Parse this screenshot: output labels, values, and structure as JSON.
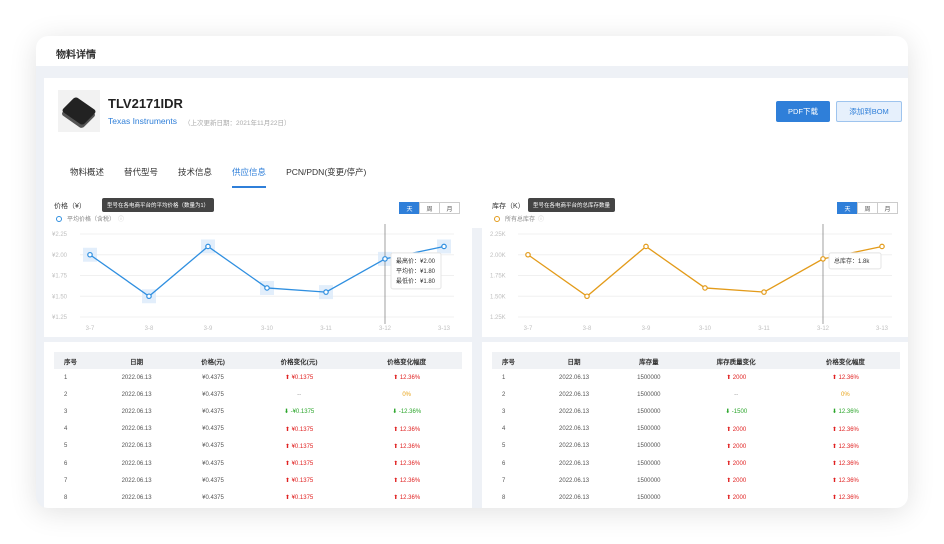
{
  "header": {
    "title": "物料详情"
  },
  "product": {
    "part_number": "TLV2171IDR",
    "manufacturer": "Texas Instruments",
    "update_date": "（上次更新日期：2021年11月22日）",
    "icon": "chip-icon"
  },
  "actions": {
    "pdf_label": "PDF下载",
    "bom_label": "添加到BOM"
  },
  "tabs": [
    "物料概述",
    "替代型号",
    "技术信息",
    "供应信息",
    "PCN/PDN(变更/停产)"
  ],
  "active_tab": "供应信息",
  "period_options": [
    "天",
    "周",
    "月"
  ],
  "colors": {
    "accent": "#2f7fd9",
    "price_line": "#2f8fe0",
    "stock_line": "#e39b1a",
    "up": "#e02020",
    "down": "#2aa52a"
  },
  "price_chart": {
    "title": "价格（¥）",
    "tooltip": "型号在各电商平台的平均价格（数量为1）",
    "legend": "平均价格（含税）",
    "hover": {
      "max_label": "最高价：¥2.00",
      "avg_label": "平均价：¥1.80",
      "min_label": "最低价：¥1.80"
    }
  },
  "stock_chart": {
    "title": "库存（K）",
    "tooltip": "型号在各电商平台的总库存数量",
    "legend": "所有总库存",
    "hover": {
      "total_label": "总库存：1.8k"
    }
  },
  "chart_data": [
    {
      "type": "line",
      "title": "价格（¥）",
      "categories": [
        "3-7",
        "3-8",
        "3-9",
        "3-10",
        "3-11",
        "3-12",
        "3-13"
      ],
      "y_ticks": [
        "¥2.25",
        "¥2.00",
        "¥1.75",
        "¥1.50",
        "¥1.25"
      ],
      "ylim": [
        1.25,
        2.25
      ],
      "series": [
        {
          "name": "平均价格（含税）",
          "values": [
            2.0,
            1.5,
            2.1,
            1.6,
            1.55,
            1.95,
            2.1
          ]
        }
      ],
      "grid": true,
      "legend_position": "top-left"
    },
    {
      "type": "line",
      "title": "库存（K）",
      "categories": [
        "3-7",
        "3-8",
        "3-9",
        "3-10",
        "3-11",
        "3-12",
        "3-13"
      ],
      "y_ticks": [
        "2.25K",
        "2.00K",
        "1.75K",
        "1.50K",
        "1.25K"
      ],
      "ylim": [
        1.25,
        2.25
      ],
      "series": [
        {
          "name": "所有总库存",
          "values": [
            2.0,
            1.5,
            2.1,
            1.6,
            1.55,
            1.95,
            2.1
          ]
        }
      ],
      "grid": true,
      "legend_position": "top-left"
    }
  ],
  "price_table": {
    "headers": [
      "序号",
      "日期",
      "价格(元)",
      "价格变化(元)",
      "价格变化幅度"
    ],
    "rows": [
      {
        "no": "1",
        "date": "2022.06.13",
        "price": "¥0.4375",
        "change": "¥0.1375",
        "change_dir": "up",
        "pct": "12.36%",
        "pct_dir": "up"
      },
      {
        "no": "2",
        "date": "2022.06.13",
        "price": "¥0.4375",
        "change": "--",
        "change_dir": "none",
        "pct": "0%",
        "pct_dir": "flat"
      },
      {
        "no": "3",
        "date": "2022.06.13",
        "price": "¥0.4375",
        "change": "-¥0.1375",
        "change_dir": "down",
        "pct": "-12.36%",
        "pct_dir": "down"
      },
      {
        "no": "4",
        "date": "2022.06.13",
        "price": "¥0.4375",
        "change": "¥0.1375",
        "change_dir": "up",
        "pct": "12.36%",
        "pct_dir": "up"
      },
      {
        "no": "5",
        "date": "2022.06.13",
        "price": "¥0.4375",
        "change": "¥0.1375",
        "change_dir": "up",
        "pct": "12.36%",
        "pct_dir": "up"
      },
      {
        "no": "6",
        "date": "2022.06.13",
        "price": "¥0.4375",
        "change": "¥0.1375",
        "change_dir": "up",
        "pct": "12.36%",
        "pct_dir": "up"
      },
      {
        "no": "7",
        "date": "2022.06.13",
        "price": "¥0.4375",
        "change": "¥0.1375",
        "change_dir": "up",
        "pct": "12.36%",
        "pct_dir": "up"
      },
      {
        "no": "8",
        "date": "2022.06.13",
        "price": "¥0.4375",
        "change": "¥0.1375",
        "change_dir": "up",
        "pct": "12.36%",
        "pct_dir": "up"
      }
    ]
  },
  "stock_table": {
    "headers": [
      "序号",
      "日期",
      "库存量",
      "库存质量变化",
      "价格变化幅度"
    ],
    "rows": [
      {
        "no": "1",
        "date": "2022.06.13",
        "qty": "1500000",
        "change": "2000",
        "change_dir": "up",
        "pct": "12.36%",
        "pct_dir": "up"
      },
      {
        "no": "2",
        "date": "2022.06.13",
        "qty": "1500000",
        "change": "--",
        "change_dir": "none",
        "pct": "0%",
        "pct_dir": "flat"
      },
      {
        "no": "3",
        "date": "2022.06.13",
        "qty": "1500000",
        "change": "-1500",
        "change_dir": "down",
        "pct": "12.36%",
        "pct_dir": "down"
      },
      {
        "no": "4",
        "date": "2022.06.13",
        "qty": "1500000",
        "change": "2000",
        "change_dir": "up",
        "pct": "12.36%",
        "pct_dir": "up"
      },
      {
        "no": "5",
        "date": "2022.06.13",
        "qty": "1500000",
        "change": "2000",
        "change_dir": "up",
        "pct": "12.36%",
        "pct_dir": "up"
      },
      {
        "no": "6",
        "date": "2022.06.13",
        "qty": "1500000",
        "change": "2000",
        "change_dir": "up",
        "pct": "12.36%",
        "pct_dir": "up"
      },
      {
        "no": "7",
        "date": "2022.06.13",
        "qty": "1500000",
        "change": "2000",
        "change_dir": "up",
        "pct": "12.36%",
        "pct_dir": "up"
      },
      {
        "no": "8",
        "date": "2022.06.13",
        "qty": "1500000",
        "change": "2000",
        "change_dir": "up",
        "pct": "12.36%",
        "pct_dir": "up"
      }
    ]
  }
}
